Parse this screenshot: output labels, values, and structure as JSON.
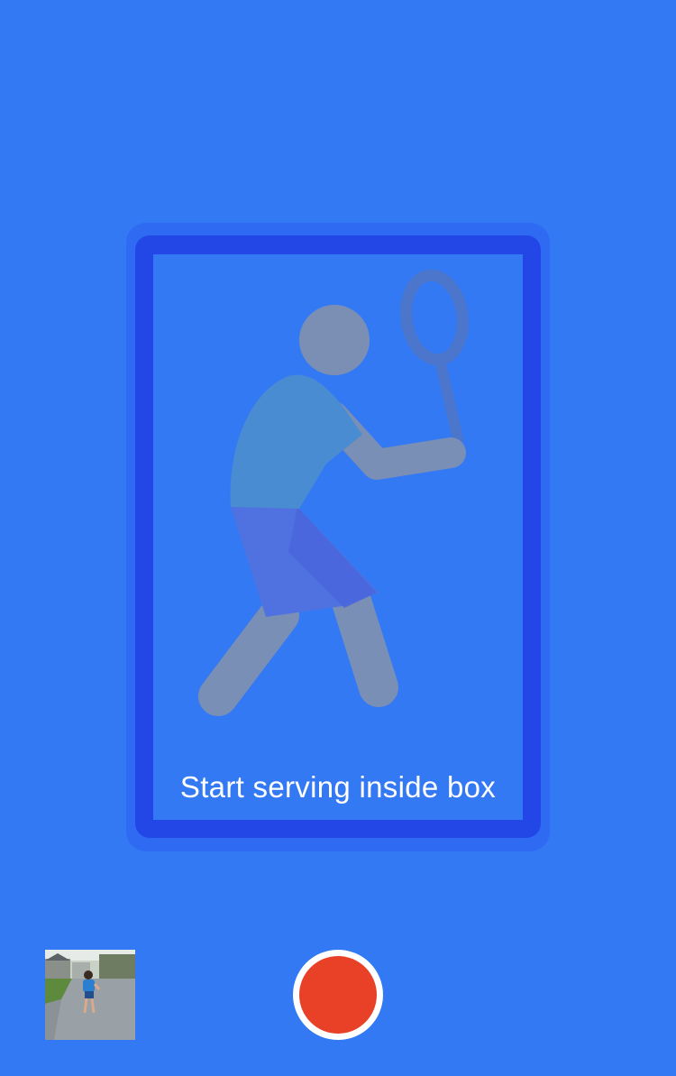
{
  "colors": {
    "background": "#3479f4",
    "frame_outer": "#2f6bf2",
    "frame_inner": "#2247e6",
    "figure_head": "#7b8fb5",
    "figure_shirt": "#4a8cd1",
    "figure_shorts": "#4f72e0",
    "figure_limbs": "#7a8fb6",
    "racket": "#4b76cc",
    "record_button": "#e84127",
    "record_ring": "#ffffff"
  },
  "serve_box": {
    "hint_label": "Start serving inside box",
    "illustration_icon": "tennis-player-serving-icon"
  },
  "controls": {
    "last_video_thumbnail": "video-thumbnail",
    "record_button": "record-icon"
  }
}
